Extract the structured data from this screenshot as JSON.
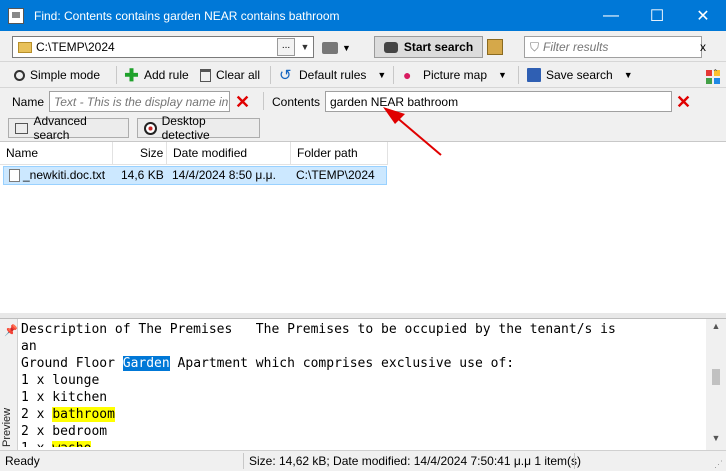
{
  "window": {
    "title": "Find: Contents contains garden NEAR contains bathroom",
    "minimize_glyph": "—",
    "maximize_glyph": "☐",
    "close_glyph": "✕"
  },
  "toolbar_top": {
    "path_value": "C:\\TEMP\\2024",
    "browse_label": "...",
    "start_search_label": "Start search",
    "filter_placeholder": "Filter results",
    "filter_clear": "x"
  },
  "toolbar_actions": {
    "simple_mode": "Simple mode",
    "add_rule": "Add rule",
    "clear_all": "Clear all",
    "default_rules": "Default rules",
    "picture_map": "Picture map",
    "save_search": "Save search"
  },
  "rules": {
    "name_label": "Name",
    "name_placeholder": "Text - This is the display name in",
    "contents_label": "Contents",
    "contents_value": "garden NEAR bathroom"
  },
  "modes": {
    "advanced_search": "Advanced search",
    "desktop_detective": "Desktop detective"
  },
  "results": {
    "columns": [
      "Name",
      "Size",
      "Date modified",
      "Folder path"
    ],
    "rows": [
      {
        "name": "_newkiti.doc.txt",
        "size": "14,6 KB",
        "date": "14/4/2024 8:50 μ.μ.",
        "folder": "C:\\TEMP\\2024"
      }
    ]
  },
  "preview": {
    "side_label": "Preview",
    "line1": "Description of The Premises   The Premises to be occupied by the tenant/s is",
    "line2": "an",
    "line3_pre": "Ground Floor ",
    "line3_hl": "Garden",
    "line3_post": " Apartment which comprises exclusive use of:",
    "line4": "1 x lounge",
    "line5": "1 x kitchen",
    "line6_pre": "2 x ",
    "line6_hl": "bathroom",
    "line7": "2 x bedroom",
    "line8_pre": "1 x ",
    "line8_hl": "washo"
  },
  "status": {
    "ready": "Ready",
    "info": "Size: 14,62 kB; Date modified: 14/4/2024 7:50:41 μ.μ 1 item(s)"
  },
  "colors": {
    "titlebar": "#0078d7",
    "selection": "#cce8ff",
    "highlight_selected": "#0078d7",
    "highlight_match": "#ffff00",
    "annotation_arrow": "#e00000"
  }
}
